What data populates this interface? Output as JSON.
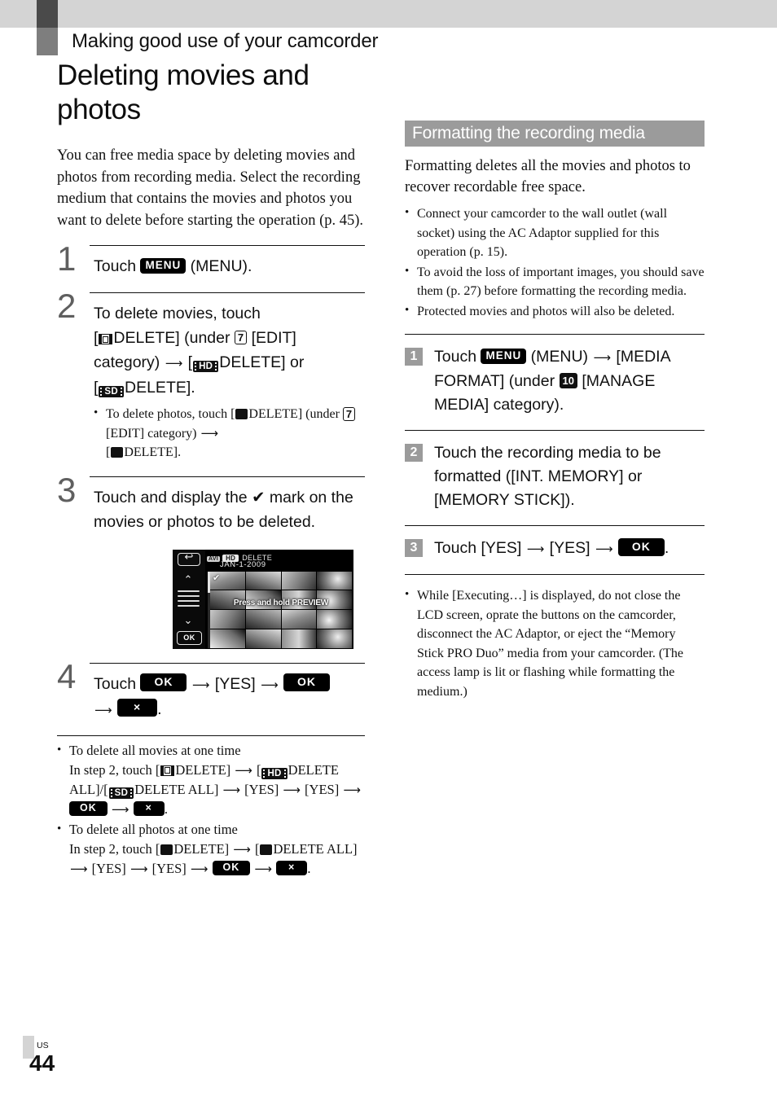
{
  "running_head": "Making good use of your camcorder",
  "page_title": "Deleting movies and photos",
  "intro": "You can free media space by deleting movies and photos from recording media. Select the recording medium that contains the movies and photos you want to delete before starting the operation (p. 45).",
  "steps": {
    "s1": {
      "number": "1",
      "touch": "Touch",
      "menu_badge": "MENU",
      "menu_label": "(MENU)."
    },
    "s2": {
      "number": "2",
      "line1": "To delete movies, touch",
      "open_bracket": "[",
      "delete_label": "DELETE] (under",
      "cat_number": "7",
      "edit_label": "[EDIT] category)",
      "hd_badge": "HD",
      "hd_delete": "DELETE] or",
      "sd_badge": "SD",
      "sd_delete": "DELETE].",
      "sub_bullet": {
        "part1": "To delete photos, touch [",
        "part2": "DELETE] (under",
        "cat_number": "7",
        "part3": "[EDIT] category)",
        "part4": "[",
        "part5": "DELETE]."
      }
    },
    "s3": {
      "number": "3",
      "text_before": "Touch and display the",
      "check": "✔",
      "text_after": "mark on the movies or photos to be deleted."
    },
    "s4": {
      "number": "4",
      "touch": "Touch",
      "ok1": "OK",
      "yes": "[YES]",
      "ok2": "OK",
      "close": "×",
      "period": "."
    }
  },
  "lcd_figure": {
    "back_icon": "back-arrow",
    "mode_badge": "AVI",
    "hd_badge": "HD",
    "title": "DELETE",
    "date": "JAN-1-2009",
    "preview_hint": "Press and hold PREVIEW",
    "ok_button": "OK",
    "up_arrow": "⌃",
    "down_arrow": "⌄",
    "checkmark": "✔"
  },
  "left_notes": [
    {
      "heading": "To delete all movies at one time",
      "line_prefix": "In step 2, touch [",
      "delete": "DELETE]",
      "hd_badge": "HD",
      "hd_delete_all": "DELETE ALL]/[",
      "sd_badge": "SD",
      "sd_delete_all": "DELETE ALL]",
      "yes1": "[YES]",
      "yes2": "[YES]",
      "ok": "OK",
      "close": "×"
    },
    {
      "heading": "To delete all photos at one time",
      "line_prefix": "In step 2, touch [",
      "delete": "DELETE]",
      "delete_all": "DELETE ALL]",
      "yes1": "[YES]",
      "yes2": "[YES]",
      "ok": "OK",
      "close": "×"
    }
  ],
  "right": {
    "section_title": "Formatting the recording media",
    "section_intro": "Formatting deletes all the movies and photos to recover recordable free space.",
    "bullets": [
      "Connect your camcorder to the wall outlet (wall socket) using the AC Adaptor supplied for this operation (p. 15).",
      "To avoid the loss of important images, you should save them (p. 27) before formatting the recording media.",
      "Protected movies and photos will also be deleted."
    ],
    "steps": [
      {
        "number": "1",
        "touch": "Touch",
        "menu_badge": "MENU",
        "after_menu": "(MENU)",
        "media_format": "[MEDIA FORMAT] (under",
        "cat_number": "10",
        "manage_media": "[MANAGE MEDIA] category)."
      },
      {
        "number": "2",
        "text": "Touch the recording media to be formatted ([INT. MEMORY] or [MEMORY STICK])."
      },
      {
        "number": "3",
        "touch": "Touch [YES]",
        "yes2": "[YES]",
        "ok": "OK",
        "period": "."
      }
    ],
    "final_note": "While [Executing…] is displayed, do not close the LCD screen, oprate the buttons on the camcorder, disconnect the AC Adaptor, or eject the “Memory Stick PRO Duo” media from your camcorder. (The access lamp is lit or flashing while formatting the medium.)"
  },
  "footer": {
    "region": "US",
    "page_number": "44"
  },
  "colors": {
    "band": "#d4d4d4",
    "tab_dark": "#4a4a4a",
    "tab_mid": "#7e7e7e",
    "section_header_bg": "#9b9b9b",
    "step_number": "#5f5f5f"
  }
}
